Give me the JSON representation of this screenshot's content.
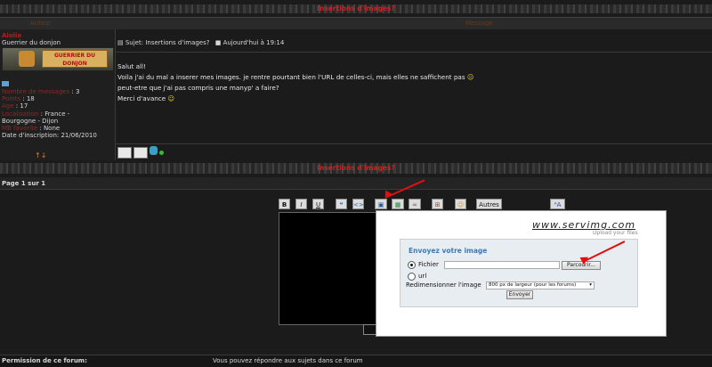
{
  "topic": {
    "title": "Insertions d'images?",
    "col_author": "Auteur",
    "col_message": "Message"
  },
  "author": {
    "name": "Aiolia",
    "rank": "Guerrier du donjon",
    "rank_banner": "GUERRIER DU DONJON",
    "rows": [
      {
        "label": "Nombre de messages",
        "value": ": 3"
      },
      {
        "label": "Points",
        "value": ": 18"
      },
      {
        "label": "Age",
        "value": ": 17"
      },
      {
        "label": "Localisation",
        "value": ": France -"
      },
      {
        "label": "",
        "value": "Bourgogne - Dijon"
      },
      {
        "label": "MB favorite",
        "value": ": None"
      },
      {
        "label": "Date d'inscription",
        "value": ": 21/06/2010"
      }
    ]
  },
  "post": {
    "subject": "Sujet: Insertions d'images?",
    "date": "Aujourd'hui à 19:14",
    "lines": [
      "Salut all!",
      "Voila j'ai du mal a inserer mes images. je rentre pourtant bien l'URL de celles-ci, mais elles ne saffichent pas",
      "peut-etre que j'ai pas compris une manyp' a faire?",
      "Merci d'avance"
    ]
  },
  "bottom": {
    "title": "Insertions d'images?",
    "page_info": "Page 1 sur 1",
    "toolbar": {
      "bold": "B",
      "italic": "I",
      "underline": "U",
      "other": "Autres"
    },
    "permission_label": "Permission de ce forum:",
    "permission_text": "Vous pouvez répondre aux sujets dans ce forum"
  },
  "upload": {
    "logo": "www.servimg.com",
    "tagline": "Upload your files",
    "heading": "Envoyez votre image",
    "opt_file": "Fichier",
    "opt_url": "url",
    "browse": "Parcourir...",
    "resize_label": "Redimensionner l'image",
    "resize_value": "800 px de largeur (pour les forums)",
    "submit": "Envoyer"
  }
}
